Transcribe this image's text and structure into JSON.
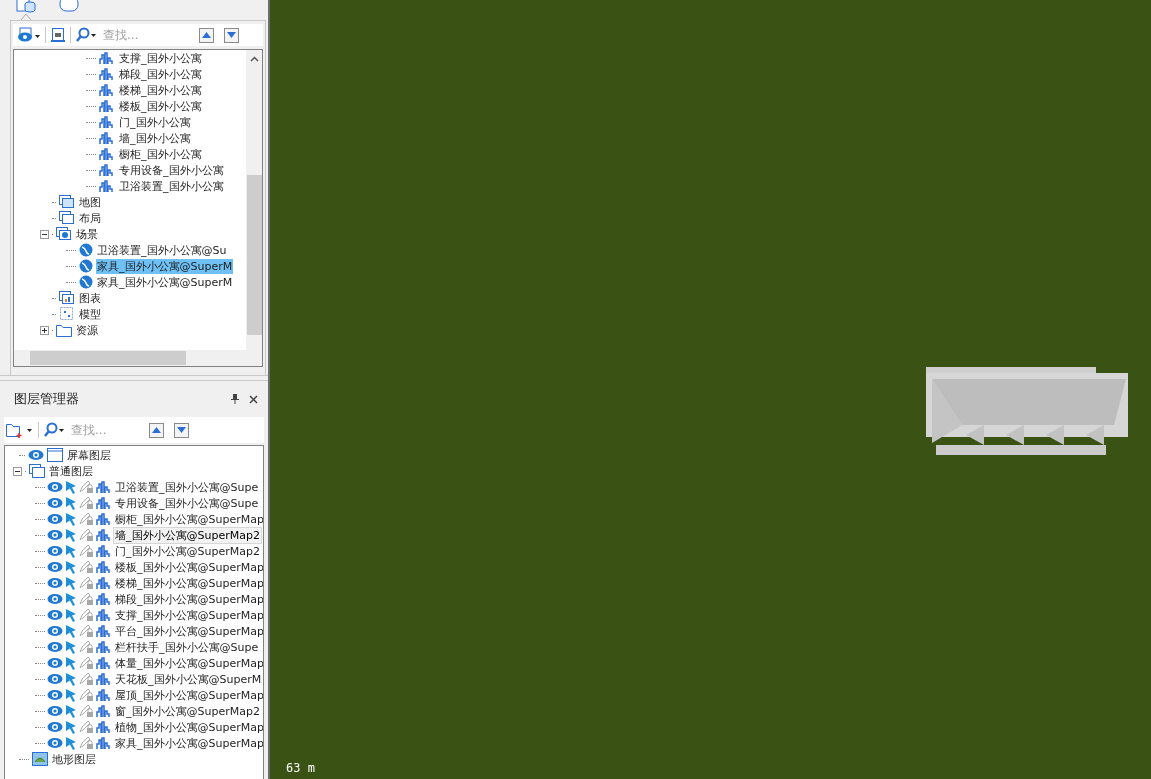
{
  "workspace_panel": {
    "tabs": [
      {
        "kind": "workspace",
        "selected": true
      },
      {
        "kind": "resources",
        "selected": false
      }
    ],
    "toolbar": {
      "search": {
        "placeholder": "查找..."
      }
    },
    "tree": {
      "datasets": [
        {
          "label": "支撑_国外小公寓"
        },
        {
          "label": "梯段_国外小公寓"
        },
        {
          "label": "楼梯_国外小公寓"
        },
        {
          "label": "楼板_国外小公寓"
        },
        {
          "label": "门_国外小公寓"
        },
        {
          "label": "墙_国外小公寓"
        },
        {
          "label": "橱柜_国外小公寓"
        },
        {
          "label": "专用设备_国外小公寓"
        },
        {
          "label": "卫浴装置_国外小公寓"
        }
      ],
      "items": [
        {
          "kind": "map",
          "label": "地图"
        },
        {
          "kind": "layout",
          "label": "布局"
        },
        {
          "kind": "scene",
          "label": "场景",
          "expanded": true,
          "children": [
            {
              "label": "卫浴装置_国外小公寓@Su",
              "selected": false
            },
            {
              "label": "家具_国外小公寓@SuperM",
              "selected": true
            },
            {
              "label": "家具_国外小公寓@SuperM",
              "selected": false
            }
          ]
        },
        {
          "kind": "chart",
          "label": "图表"
        },
        {
          "kind": "model",
          "label": "模型"
        },
        {
          "kind": "resource",
          "label": "资源",
          "expanded": false
        }
      ]
    }
  },
  "layer_manager": {
    "title": "图层管理器",
    "toolbar": {
      "search": {
        "placeholder": "查找..."
      }
    },
    "groups": [
      {
        "kind": "screen",
        "label": "屏幕图层"
      },
      {
        "kind": "normal",
        "label": "普通图层",
        "expanded": true,
        "layers": [
          {
            "label": "卫浴装置_国外小公寓@Supe",
            "selected": false
          },
          {
            "label": "专用设备_国外小公寓@Supe",
            "selected": false
          },
          {
            "label": "橱柜_国外小公寓@SuperMap",
            "selected": false
          },
          {
            "label": "墙_国外小公寓@SuperMap2",
            "selected": true
          },
          {
            "label": "门_国外小公寓@SuperMap2",
            "selected": false
          },
          {
            "label": "楼板_国外小公寓@SuperMap",
            "selected": false
          },
          {
            "label": "楼梯_国外小公寓@SuperMap",
            "selected": false
          },
          {
            "label": "梯段_国外小公寓@SuperMap",
            "selected": false
          },
          {
            "label": "支撑_国外小公寓@SuperMap",
            "selected": false
          },
          {
            "label": "平台_国外小公寓@SuperMap",
            "selected": false
          },
          {
            "label": "栏杆扶手_国外小公寓@Supe",
            "selected": false
          },
          {
            "label": "体量_国外小公寓@SuperMap",
            "selected": false
          },
          {
            "label": "天花板_国外小公寓@SuperM",
            "selected": false
          },
          {
            "label": "屋顶_国外小公寓@SuperMap",
            "selected": false
          },
          {
            "label": "窗_国外小公寓@SuperMap2",
            "selected": false
          },
          {
            "label": "植物_国外小公寓@SuperMap",
            "selected": false
          },
          {
            "label": "家具_国外小公寓@SuperMap",
            "selected": false
          }
        ]
      },
      {
        "kind": "terrain",
        "label": "地形图层"
      }
    ]
  },
  "scene": {
    "scale_label": "63 m"
  }
}
